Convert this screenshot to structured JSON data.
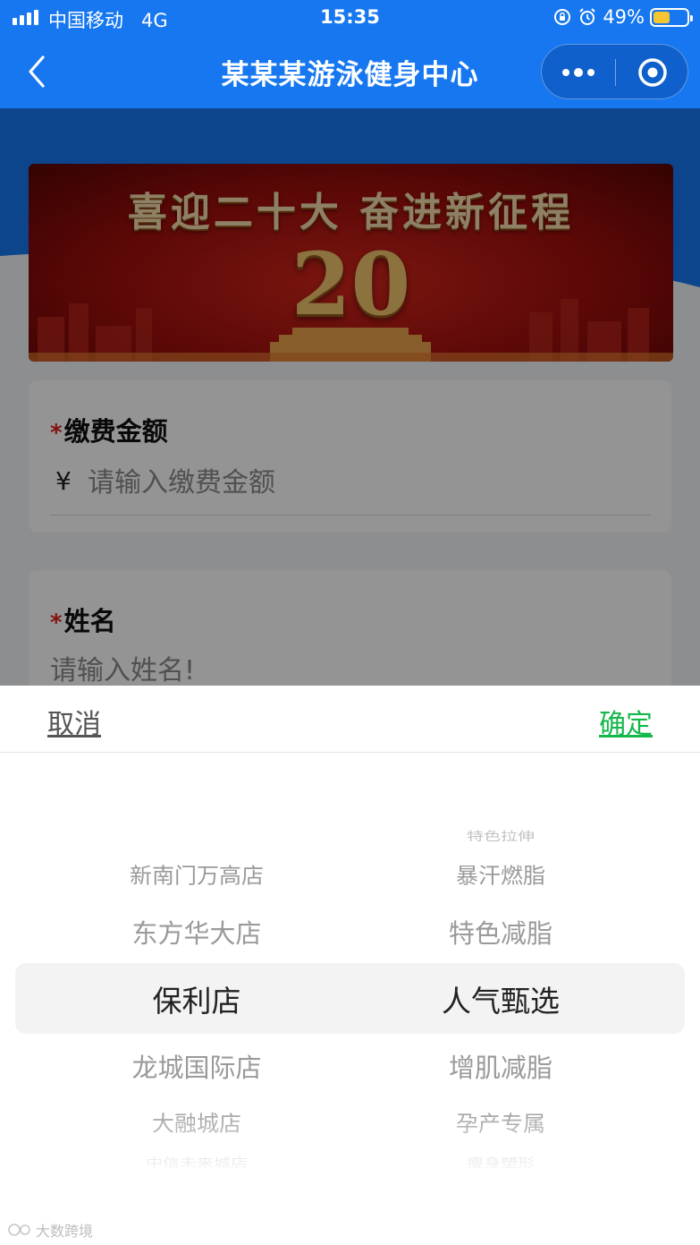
{
  "status_bar": {
    "carrier": "中国移动",
    "network": "4G",
    "time": "15:35",
    "battery_percent": "49%",
    "battery_level": 0.49
  },
  "navbar": {
    "title": "某某某游泳健身中心"
  },
  "banner": {
    "title": "喜迎二十大  奋进新征程",
    "number": "20"
  },
  "form": {
    "amount": {
      "label": "缴费金额",
      "required_mark": "*",
      "currency": "¥",
      "placeholder": "请输入缴费金额",
      "value": ""
    },
    "name": {
      "label": "姓名",
      "required_mark": "*",
      "placeholder": "请输入姓名!",
      "value": ""
    }
  },
  "picker": {
    "cancel_label": "取消",
    "confirm_label": "确定",
    "stores": [
      "新南门万高店",
      "东方华大店",
      "保利店",
      "龙城国际店",
      "大融城店",
      "中信未来城店"
    ],
    "selected_store": "保利店",
    "classes": [
      "特色拉伸",
      "暴汗燃脂",
      "特色减脂",
      "人气甄选",
      "增肌减脂",
      "孕产专属",
      "瘦身塑形"
    ],
    "selected_class": "人气甄选"
  },
  "watermark": {
    "text": "大数跨境"
  },
  "colors": {
    "nav_blue": "#1677f0",
    "confirm_green": "#15b74c",
    "required_red": "#e12222",
    "battery_yellow": "#f7c531"
  }
}
